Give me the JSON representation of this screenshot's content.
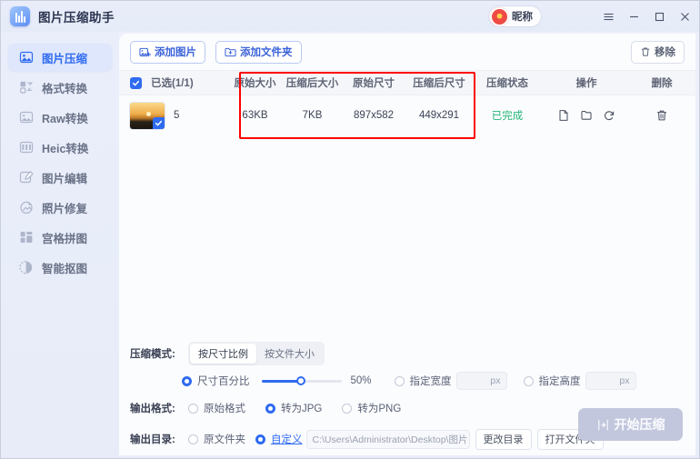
{
  "window": {
    "title": "图片压缩助手",
    "logo_icon": "compress-app-icon",
    "user": {
      "name": "昵称",
      "avatar_icon": "user-avatar-icon"
    },
    "controls": {
      "menu": "menu-icon",
      "minimize": "minimize-icon",
      "maximize": "maximize-icon",
      "close": "close-icon"
    }
  },
  "sidebar": {
    "items": [
      {
        "label": "图片压缩",
        "icon": "image-compress-icon",
        "active": true
      },
      {
        "label": "格式转换",
        "icon": "format-convert-icon",
        "active": false
      },
      {
        "label": "Raw转换",
        "icon": "raw-convert-icon",
        "active": false
      },
      {
        "label": "Heic转换",
        "icon": "heic-convert-icon",
        "active": false
      },
      {
        "label": "图片编辑",
        "icon": "image-edit-icon",
        "active": false
      },
      {
        "label": "照片修复",
        "icon": "photo-repair-icon",
        "active": false
      },
      {
        "label": "宫格拼图",
        "icon": "grid-collage-icon",
        "active": false
      },
      {
        "label": "智能抠图",
        "icon": "smart-cutout-icon",
        "active": false
      }
    ]
  },
  "toolbar": {
    "add_image": "添加图片",
    "add_folder": "添加文件夹",
    "remove": "移除"
  },
  "table": {
    "headers": {
      "selection": "已选(1/1)",
      "original_size": "原始大小",
      "compressed_size": "压缩后大小",
      "original_dimension": "原始尺寸",
      "compressed_dimension": "压缩后尺寸",
      "status": "压缩状态",
      "operation": "操作",
      "delete": "删除"
    },
    "rows": [
      {
        "filename": "5",
        "original_size": "63KB",
        "compressed_size": "7KB",
        "original_dimension": "897x582",
        "compressed_dimension": "449x291",
        "status": "已完成",
        "checked": true,
        "thumbnail": "sunset-thumbnail",
        "ops": [
          "open-file-icon",
          "open-folder-icon",
          "recompress-icon"
        ],
        "delete_icon": "trash-icon"
      }
    ]
  },
  "highlight": {
    "color": "#ff0000"
  },
  "options": {
    "mode_label": "压缩模式:",
    "modes": [
      {
        "label": "按尺寸比例",
        "selected": true
      },
      {
        "label": "按文件大小",
        "selected": false
      }
    ],
    "scale": {
      "label": "尺寸百分比",
      "selected": true,
      "value": "50%"
    },
    "width": {
      "label": "指定宽度",
      "selected": false,
      "value": "",
      "unit": "px"
    },
    "height": {
      "label": "指定高度",
      "selected": false,
      "value": "",
      "unit": "px"
    },
    "format_label": "输出格式:",
    "formats": [
      {
        "label": "原始格式",
        "selected": false
      },
      {
        "label": "转为JPG",
        "selected": true
      },
      {
        "label": "转为PNG",
        "selected": false
      }
    ],
    "dir_label": "输出目录:",
    "dir_original": "原文件夹",
    "dir_custom": "自定义",
    "dir_path": "C:\\Users\\Administrator\\Desktop\\图片",
    "change_dir": "更改目录",
    "open_folder": "打开文件夹",
    "start_button": "开始压缩",
    "start_icon": "compress-start-icon"
  },
  "colors": {
    "accent": "#2f6bf0",
    "success": "#22b573",
    "highlight": "#ff0000",
    "disabled": "#c3c7dd"
  }
}
